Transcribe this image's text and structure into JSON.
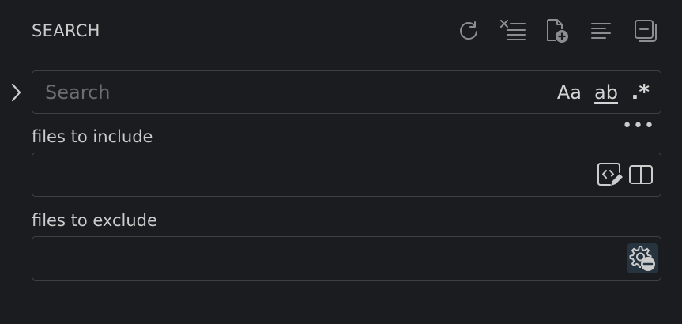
{
  "header": {
    "title": "SEARCH",
    "actions": [
      {
        "name": "refresh-icon"
      },
      {
        "name": "clear-results-icon"
      },
      {
        "name": "new-search-editor-icon"
      },
      {
        "name": "view-as-tree-icon"
      },
      {
        "name": "collapse-all-icon"
      }
    ]
  },
  "search": {
    "placeholder": "Search",
    "value": "",
    "options": {
      "match_case_label": "Aa",
      "whole_word_label": "ab",
      "regex_label": ".*"
    }
  },
  "more_label": "•••",
  "include": {
    "label": "files to include",
    "value": ""
  },
  "exclude": {
    "label": "files to exclude",
    "value": ""
  },
  "colors": {
    "background": "#1b1c1f",
    "border": "#3e4045",
    "text": "#cccccc",
    "icon": "#8b8d91",
    "active_button_bg": "#26343f"
  }
}
